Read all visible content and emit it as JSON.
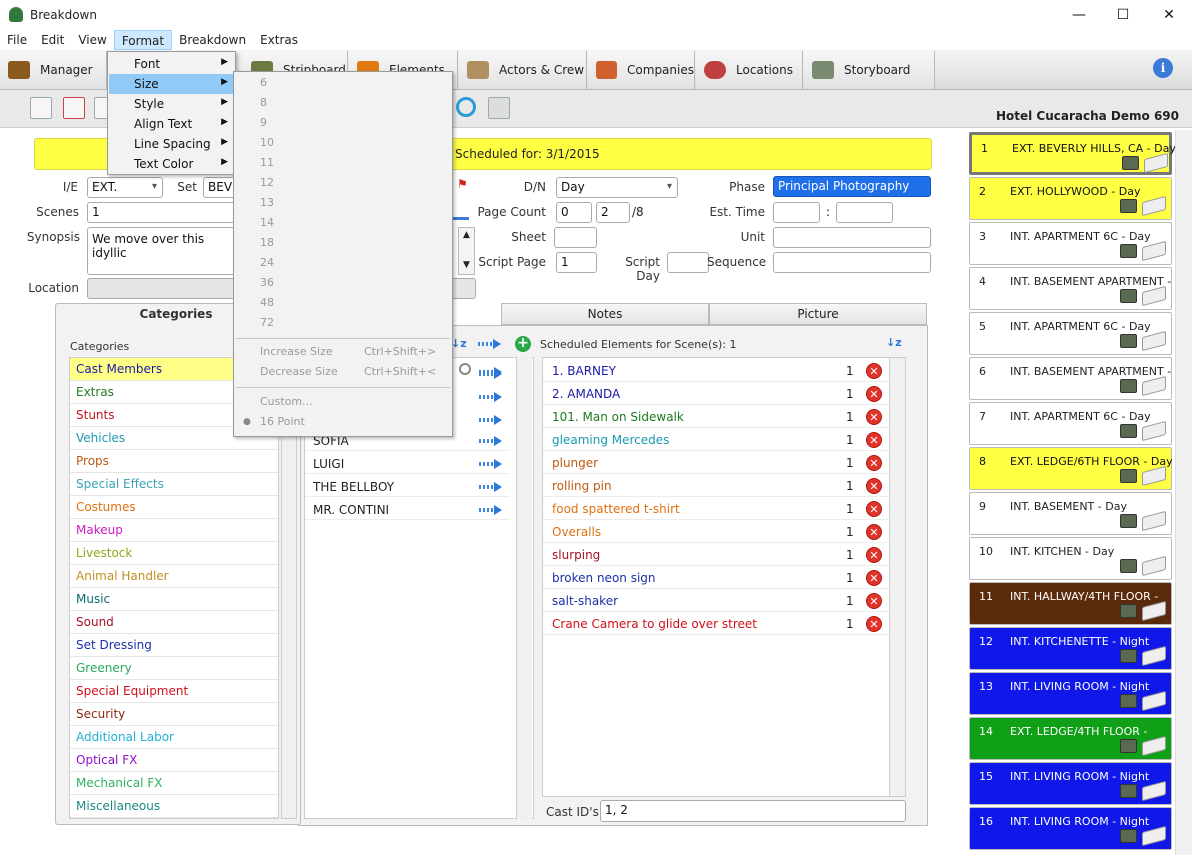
{
  "window": {
    "title": "Breakdown",
    "min": "—",
    "max": "☐",
    "close": "✕"
  },
  "menubar": [
    "File",
    "Edit",
    "View",
    "Format",
    "Breakdown",
    "Extras"
  ],
  "modules": [
    {
      "label": "Manager",
      "icon": "briefcase-icon"
    },
    {
      "label": "Stripboard",
      "icon": "stripboard-icon"
    },
    {
      "label": "Elements",
      "icon": "elements-icon"
    },
    {
      "label": "Actors & Crew",
      "icon": "actors-icon"
    },
    {
      "label": "Companies",
      "icon": "companies-icon"
    },
    {
      "label": "Locations",
      "icon": "locations-icon"
    },
    {
      "label": "Storyboard",
      "icon": "storyboard-icon"
    }
  ],
  "project_title": "Hotel Cucaracha Demo 690",
  "banner": "Scheduled for: 3/1/2015",
  "form": {
    "ie_label": "I/E",
    "ie_value": "EXT.",
    "set_label": "Set",
    "set_value": "BEV",
    "scenes_label": "Scenes",
    "scenes_value": "1",
    "synopsis_label": "Synopsis",
    "synopsis_value": "We move over this idyllic",
    "location_label": "Location",
    "dn_label": "D/N",
    "dn_value": "Day",
    "phase_label": "Phase",
    "phase_value": "Principal Photography",
    "pagecount_label": "Page Count",
    "pagecount_a": "0",
    "pagecount_b": "2",
    "pagecount_den": "/8",
    "esttime_label": "Est. Time",
    "esttime_sep": ":",
    "sheet_label": "Sheet",
    "unit_label": "Unit",
    "scriptpage_label": "Script Page",
    "scriptpage_value": "1",
    "scriptday_label": "Script Day",
    "sequence_label": "Sequence"
  },
  "tabs": {
    "categories": "Categories",
    "notes": "Notes",
    "picture": "Picture"
  },
  "categories_header": "Categories",
  "categories": [
    {
      "name": "Cast Members",
      "color": "#1a1aa8"
    },
    {
      "name": "Extras",
      "color": "#1f7a1f"
    },
    {
      "name": "Stunts",
      "color": "#c0161d"
    },
    {
      "name": "Vehicles",
      "color": "#1a9ab0"
    },
    {
      "name": "Props",
      "color": "#c05a10"
    },
    {
      "name": "Special Effects",
      "color": "#3aa5b5"
    },
    {
      "name": "Costumes",
      "color": "#e07010"
    },
    {
      "name": "Makeup",
      "color": "#d01cc0"
    },
    {
      "name": "Livestock",
      "color": "#90a81a"
    },
    {
      "name": "Animal Handler",
      "color": "#c09020"
    },
    {
      "name": "Music",
      "color": "#0a6a70"
    },
    {
      "name": "Sound",
      "color": "#a8102a"
    },
    {
      "name": "Set Dressing",
      "color": "#1a30a8"
    },
    {
      "name": "Greenery",
      "color": "#2aa860"
    },
    {
      "name": "Special Equipment",
      "color": "#d0101a"
    },
    {
      "name": "Security",
      "color": "#8a2a10"
    },
    {
      "name": "Additional Labor",
      "color": "#20b0d0"
    },
    {
      "name": "Optical FX",
      "color": "#9010d0"
    },
    {
      "name": "Mechanical FX",
      "color": "#30b060"
    },
    {
      "name": "Miscellaneous",
      "color": "#1a8a80"
    }
  ],
  "elements": [
    "SOFIA",
    "LUIGI",
    "THE BELLBOY",
    "MR. CONTINI"
  ],
  "scheduled_header": "Scheduled Elements for Scene(s): 1",
  "scheduled": [
    {
      "name": "1. BARNEY",
      "count": "1",
      "color": "#1a1aa8"
    },
    {
      "name": "2. AMANDA",
      "count": "1",
      "color": "#1a1aa8"
    },
    {
      "name": "101. Man on Sidewalk",
      "count": "1",
      "color": "#1f7a1f"
    },
    {
      "name": "gleaming Mercedes",
      "count": "1",
      "color": "#1a9ab0"
    },
    {
      "name": "plunger",
      "count": "1",
      "color": "#c05a10"
    },
    {
      "name": "rolling pin",
      "count": "1",
      "color": "#c05a10"
    },
    {
      "name": "food spattered t-shirt",
      "count": "1",
      "color": "#e07010"
    },
    {
      "name": "Overalls",
      "count": "1",
      "color": "#e07010"
    },
    {
      "name": "slurping",
      "count": "1",
      "color": "#a8102a"
    },
    {
      "name": "broken neon sign",
      "count": "1",
      "color": "#1a30a8"
    },
    {
      "name": "salt-shaker",
      "count": "1",
      "color": "#1a30a8"
    },
    {
      "name": "Crane Camera to glide over street",
      "count": "1",
      "color": "#d0101a"
    }
  ],
  "castid_label": "Cast ID's:",
  "castid_value": "1, 2",
  "strips": [
    {
      "num": "1",
      "text": "EXT. BEVERLY HILLS, CA  - Day",
      "bg": "#ffff44",
      "fg": "#111"
    },
    {
      "num": "2",
      "text": "EXT. HOLLYWOOD  - Day",
      "bg": "#ffff44",
      "fg": "#111"
    },
    {
      "num": "3",
      "text": "INT. APARTMENT 6C  - Day",
      "bg": "#ffffff",
      "fg": "#222"
    },
    {
      "num": "4",
      "text": "INT. BASEMENT APARTMENT  -",
      "bg": "#ffffff",
      "fg": "#222"
    },
    {
      "num": "5",
      "text": "INT. APARTMENT 6C  - Day",
      "bg": "#ffffff",
      "fg": "#222"
    },
    {
      "num": "6",
      "text": "INT. BASEMENT APARTMENT  -",
      "bg": "#ffffff",
      "fg": "#222"
    },
    {
      "num": "7",
      "text": "INT. APARTMENT 6C  - Day",
      "bg": "#ffffff",
      "fg": "#222"
    },
    {
      "num": "8",
      "text": "EXT. LEDGE/6TH FLOOR  - Day",
      "bg": "#ffff44",
      "fg": "#111"
    },
    {
      "num": "9",
      "text": "INT. BASEMENT  - Day",
      "bg": "#ffffff",
      "fg": "#222"
    },
    {
      "num": "10",
      "text": "INT. KITCHEN  - Day",
      "bg": "#ffffff",
      "fg": "#222"
    },
    {
      "num": "11",
      "text": "INT. HALLWAY/4TH FLOOR  -",
      "bg": "#5b2a0c",
      "fg": "#ffffff"
    },
    {
      "num": "12",
      "text": "INT. KITCHENETTE  - Night",
      "bg": "#0f18e8",
      "fg": "#ffffff"
    },
    {
      "num": "13",
      "text": "INT. LIVING ROOM  - Night",
      "bg": "#0f18e8",
      "fg": "#ffffff"
    },
    {
      "num": "14",
      "text": "EXT. LEDGE/4TH FLOOR  -",
      "bg": "#10a018",
      "fg": "#ffffff"
    },
    {
      "num": "15",
      "text": "INT. LIVING ROOM  - Night",
      "bg": "#0f18e8",
      "fg": "#ffffff"
    },
    {
      "num": "16",
      "text": "INT. LIVING ROOM  - Night",
      "bg": "#0f18e8",
      "fg": "#ffffff"
    }
  ],
  "format_menu": [
    "Font",
    "Size",
    "Style",
    "Align Text",
    "Line Spacing",
    "Text Color"
  ],
  "size_menu": {
    "sizes": [
      "6",
      "8",
      "9",
      "10",
      "11",
      "12",
      "13",
      "14",
      "18",
      "24",
      "36",
      "48",
      "72"
    ],
    "increase": "Increase Size",
    "increase_sc": "Ctrl+Shift+>",
    "decrease": "Decrease Size",
    "decrease_sc": "Ctrl+Shift+<",
    "custom": "Custom...",
    "point": "16 Point"
  }
}
